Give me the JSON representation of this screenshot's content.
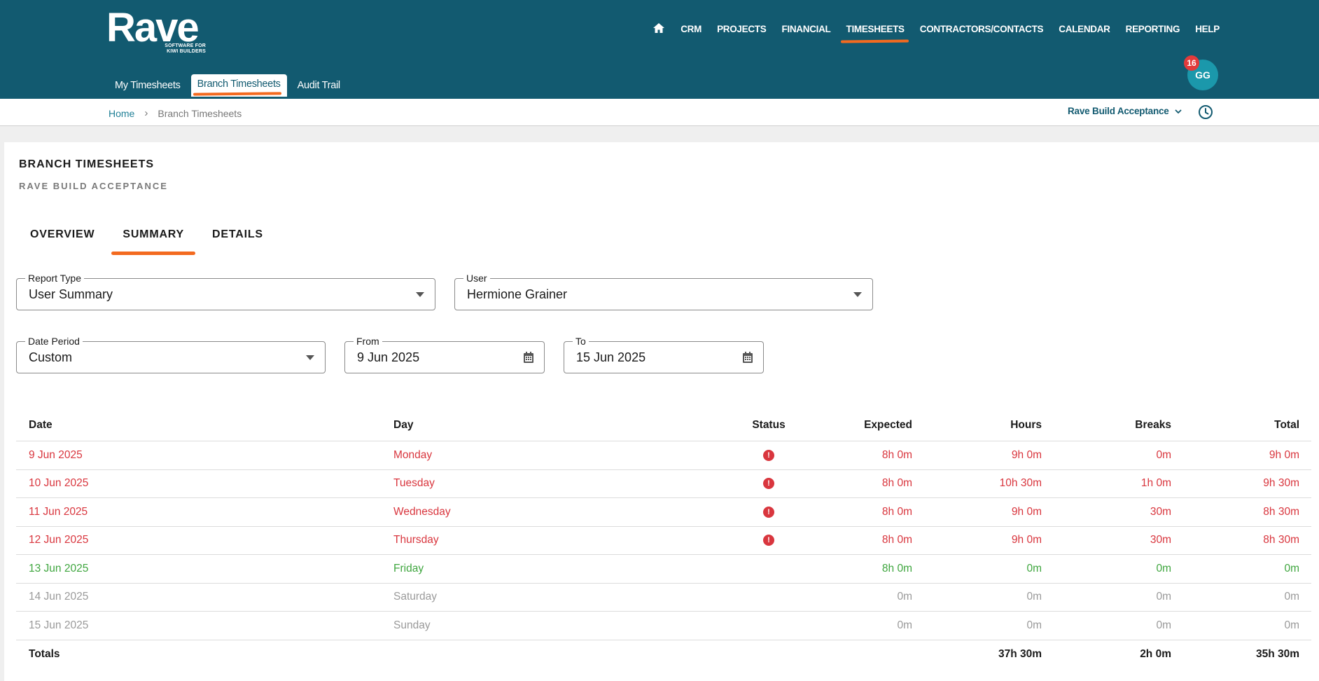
{
  "brand": {
    "name": "Rave",
    "tagline_line1": "SOFTWARE FOR",
    "tagline_line2": "KIWI BUILDERS"
  },
  "main_nav": [
    "CRM",
    "PROJECTS",
    "FINANCIAL",
    "TIMESHEETS",
    "CONTRACTORS/CONTACTS",
    "CALENDAR",
    "REPORTING",
    "HELP"
  ],
  "sub_nav": [
    "My Timesheets",
    "Branch Timesheets",
    "Audit Trail"
  ],
  "user": {
    "initials": "GG",
    "notifications": "16"
  },
  "breadcrumb": {
    "home": "Home",
    "current": "Branch Timesheets"
  },
  "branch": "Rave Build Acceptance",
  "page": {
    "title": "BRANCH TIMESHEETS",
    "subtitle": "RAVE BUILD ACCEPTANCE"
  },
  "tabs": [
    "OVERVIEW",
    "SUMMARY",
    "DETAILS"
  ],
  "filters": {
    "report_type": {
      "label": "Report Type",
      "value": "User Summary"
    },
    "user": {
      "label": "User",
      "value": "Hermione Grainer"
    },
    "date_period": {
      "label": "Date Period",
      "value": "Custom"
    },
    "from": {
      "label": "From",
      "value": "9 Jun 2025"
    },
    "to": {
      "label": "To",
      "value": "15 Jun 2025"
    }
  },
  "colors": {
    "header": "#125a70",
    "accent": "#f36a1f",
    "over": "#d9363e",
    "ok": "#3fa63f",
    "muted": "#9a9a9a"
  },
  "table": {
    "columns": [
      "Date",
      "Day",
      "Status",
      "Expected",
      "Hours",
      "Breaks",
      "Total"
    ],
    "rows": [
      {
        "date": "9 Jun 2025",
        "day": "Monday",
        "status": "!",
        "expected": "8h 0m",
        "hours": "9h 0m",
        "breaks": "0m",
        "total": "9h 0m"
      },
      {
        "date": "10 Jun 2025",
        "day": "Tuesday",
        "status": "!",
        "expected": "8h 0m",
        "hours": "10h 30m",
        "breaks": "1h 0m",
        "total": "9h 30m"
      },
      {
        "date": "11 Jun 2025",
        "day": "Wednesday",
        "status": "!",
        "expected": "8h 0m",
        "hours": "9h 0m",
        "breaks": "30m",
        "total": "8h 30m"
      },
      {
        "date": "12 Jun 2025",
        "day": "Thursday",
        "status": "!",
        "expected": "8h 0m",
        "hours": "9h 0m",
        "breaks": "30m",
        "total": "8h 30m"
      },
      {
        "date": "13 Jun 2025",
        "day": "Friday",
        "status": "",
        "expected": "8h 0m",
        "hours": "0m",
        "breaks": "0m",
        "total": "0m"
      },
      {
        "date": "14 Jun 2025",
        "day": "Saturday",
        "status": "",
        "expected": "0m",
        "hours": "0m",
        "breaks": "0m",
        "total": "0m"
      },
      {
        "date": "15 Jun 2025",
        "day": "Sunday",
        "status": "",
        "expected": "0m",
        "hours": "0m",
        "breaks": "0m",
        "total": "0m"
      }
    ],
    "totals": {
      "label": "Totals",
      "hours": "37h 30m",
      "breaks": "2h 0m",
      "total": "35h 30m"
    }
  }
}
